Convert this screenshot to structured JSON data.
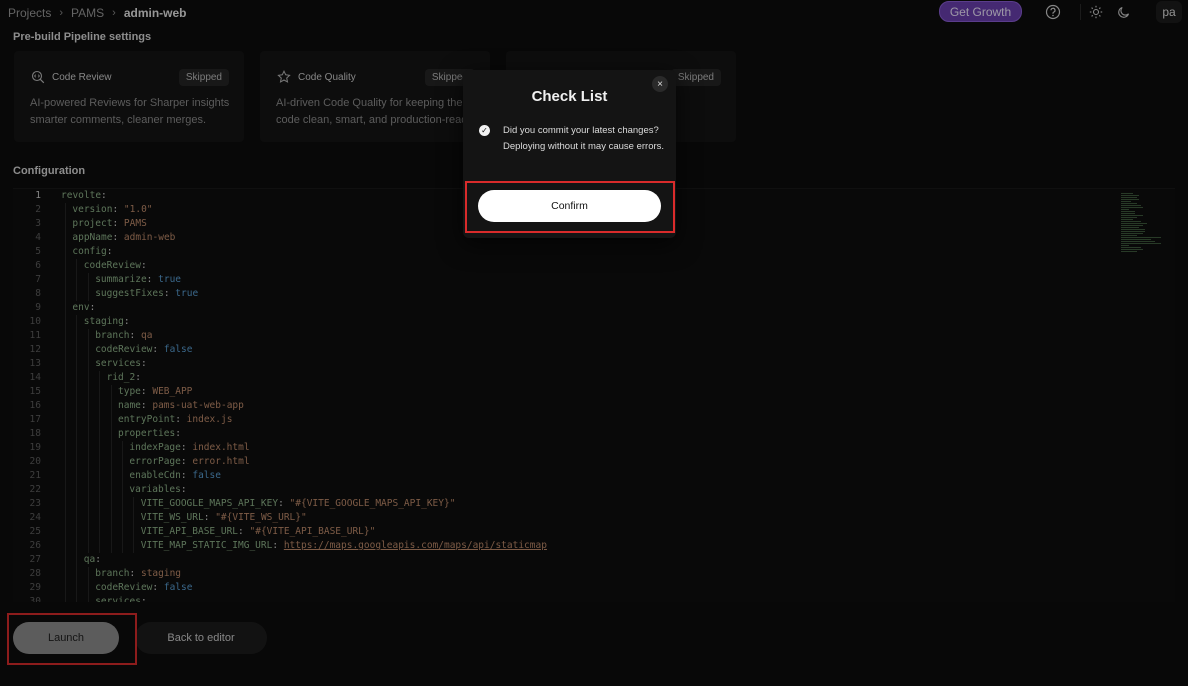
{
  "breadcrumb": [
    "Projects",
    "PAMS",
    "admin-web"
  ],
  "header": {
    "growth_label": "Get Growth",
    "avatar_initials": "pa",
    "help_icon": "help-circle-icon",
    "light_icon": "sun-icon",
    "dark_icon": "moon-icon"
  },
  "prebuild": {
    "title": "Pre-build Pipeline settings",
    "cards": [
      {
        "name": "Code Review",
        "badge": "Skipped",
        "desc1": "AI-powered Reviews for Sharper insights,",
        "desc2": "smarter comments, cleaner merges."
      },
      {
        "name": "Code Quality",
        "badge": "Skipped",
        "desc1": "AI-driven Code Quality for keeping the",
        "desc2": "code clean, smart, and production-ready."
      },
      {
        "name": "",
        "badge": "Skipped",
        "desc1": "",
        "desc2": ""
      }
    ]
  },
  "configuration": {
    "title": "Configuration",
    "line_numbers": [
      "1",
      "2",
      "3",
      "4",
      "5",
      "6",
      "7",
      "8",
      "9",
      "10",
      "11",
      "12",
      "13",
      "14",
      "15",
      "16",
      "17",
      "18",
      "19",
      "20",
      "21",
      "22",
      "23",
      "24",
      "25",
      "26",
      "27",
      "28",
      "29",
      "30"
    ],
    "lines": [
      {
        "key": "revolte",
        "value": ""
      },
      {
        "key": "version",
        "value": "\"1.0\""
      },
      {
        "key": "project",
        "value": "PAMS"
      },
      {
        "key": "appName",
        "value": "admin-web"
      },
      {
        "key": "config",
        "value": ""
      },
      {
        "key": "codeReview",
        "value": ""
      },
      {
        "key": "summarize",
        "value": "true"
      },
      {
        "key": "suggestFixes",
        "value": "true"
      },
      {
        "key": "env",
        "value": ""
      },
      {
        "key": "staging",
        "value": ""
      },
      {
        "key": "branch",
        "value": "qa"
      },
      {
        "key": "codeReview",
        "value": "false"
      },
      {
        "key": "services",
        "value": ""
      },
      {
        "key": "rid_2",
        "value": ""
      },
      {
        "key": "type",
        "value": "WEB_APP"
      },
      {
        "key": "name",
        "value": "pams-uat-web-app"
      },
      {
        "key": "entryPoint",
        "value": "index.js"
      },
      {
        "key": "properties",
        "value": ""
      },
      {
        "key": "indexPage",
        "value": "index.html"
      },
      {
        "key": "errorPage",
        "value": "error.html"
      },
      {
        "key": "enableCdn",
        "value": "false"
      },
      {
        "key": "variables",
        "value": ""
      },
      {
        "key": "VITE_GOOGLE_MAPS_API_KEY",
        "value": "\"#{VITE_GOOGLE_MAPS_API_KEY}\""
      },
      {
        "key": "VITE_WS_URL",
        "value": "\"#{VITE_WS_URL}\""
      },
      {
        "key": "VITE_API_BASE_URL",
        "value": "\"#{VITE_API_BASE_URL}\""
      },
      {
        "key": "VITE_MAP_STATIC_IMG_URL",
        "value": "https://maps.googleapis.com/maps/api/staticmap"
      },
      {
        "key": "qa",
        "value": ""
      },
      {
        "key": "branch",
        "value": "staging"
      },
      {
        "key": "codeReview",
        "value": "false"
      },
      {
        "key": "services",
        "value": ""
      }
    ]
  },
  "actions": {
    "launch_label": "Launch",
    "back_label": "Back to editor"
  },
  "dialog": {
    "title": "Check List",
    "close_glyph": "×",
    "item_text": "Did you commit your latest changes? Deploying without it may cause errors.",
    "confirm_label": "Confirm"
  },
  "colors": {
    "accent": "#6b3fb0",
    "highlight": "#d92b2b",
    "key": "#8fb48a",
    "string": "#c08c6c",
    "boolean": "#5a9fd4"
  }
}
